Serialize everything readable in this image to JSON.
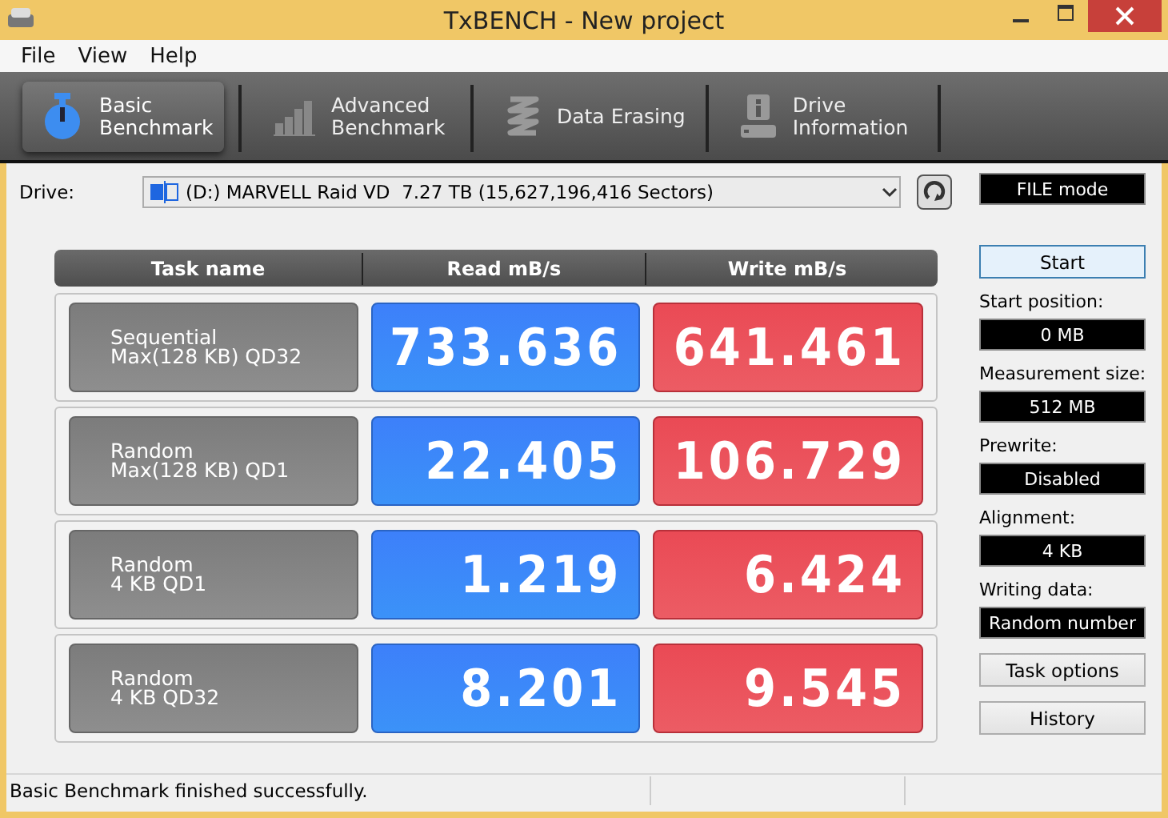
{
  "window": {
    "title": "TxBENCH - New project"
  },
  "menu": [
    "File",
    "View",
    "Help"
  ],
  "tabs": [
    {
      "kind": "timer",
      "label": "Basic\nBenchmark",
      "selected": true
    },
    {
      "kind": "bars",
      "label": "Advanced\nBenchmark",
      "selected": false
    },
    {
      "kind": "spring",
      "label": "Data Erasing",
      "selected": false
    },
    {
      "kind": "drive",
      "label": "Drive\nInformation",
      "selected": false
    }
  ],
  "drive": {
    "label": "Drive:",
    "value": "(D:) MARVELL Raid VD  7.27 TB (15,627,196,416 Sectors)"
  },
  "mode": "FILE mode",
  "table": {
    "columns": [
      "Task name",
      "Read mB/s",
      "Write mB/s"
    ],
    "rows": [
      {
        "task": "Sequential\nMax(128 KB) QD32",
        "read": "733.636",
        "write": "641.461"
      },
      {
        "task": "Random\nMax(128 KB) QD1",
        "read": "22.405",
        "write": "106.729"
      },
      {
        "task": "Random\n4 KB QD1",
        "read": "1.219",
        "write": "6.424"
      },
      {
        "task": "Random\n4 KB QD32",
        "read": "8.201",
        "write": "9.545"
      }
    ]
  },
  "start_button": "Start",
  "settings": [
    {
      "label": "Start position:",
      "value": "0 MB"
    },
    {
      "label": "Measurement size:",
      "value": "512 MB"
    },
    {
      "label": "Prewrite:",
      "value": "Disabled"
    },
    {
      "label": "Alignment:",
      "value": "4 KB"
    },
    {
      "label": "Writing data:",
      "value": "Random number"
    }
  ],
  "buttons": [
    "Task options",
    "History"
  ],
  "status_bar": "Basic Benchmark finished successfully."
}
